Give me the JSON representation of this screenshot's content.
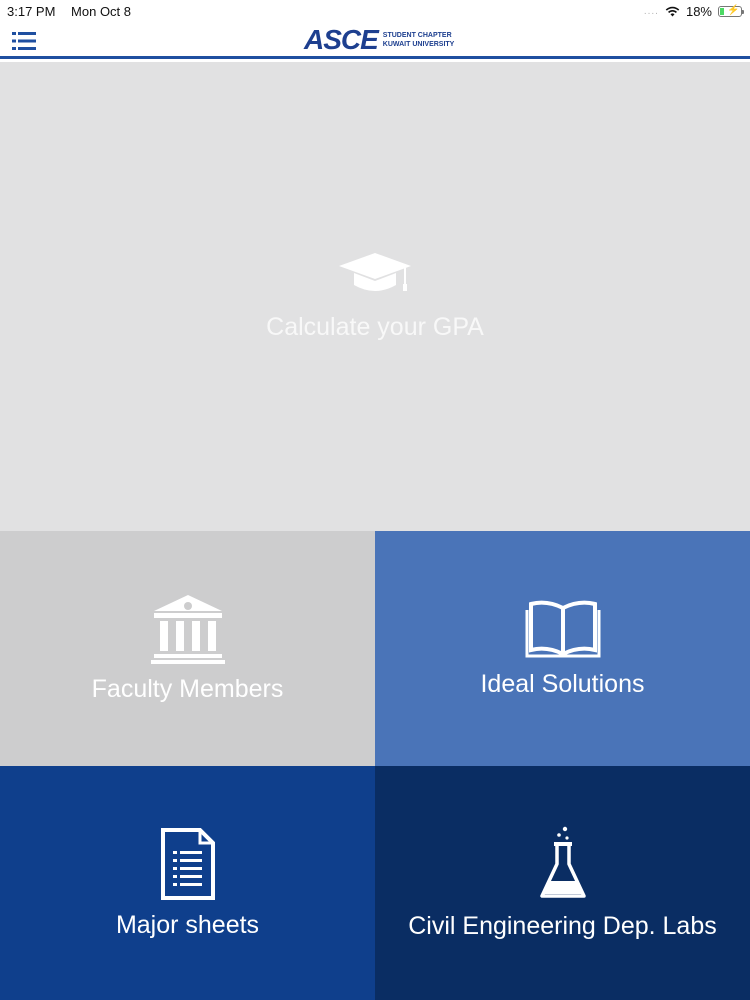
{
  "status_bar": {
    "time": "3:17 PM",
    "date": "Mon Oct 8",
    "signal_dots": "....",
    "wifi_icon": "wifi-icon",
    "battery_percent": "18%",
    "battery_level": 0.18,
    "battery_color": "#4cd964"
  },
  "header": {
    "menu_icon": "list-menu-icon",
    "logo_word": "ASCE",
    "logo_line1": "STUDENT CHAPTER",
    "logo_line2": "KUWAIT UNIVERSITY",
    "brand_color": "#1d3f8f",
    "rule_color": "#1f4fa0"
  },
  "tiles": {
    "gpa": {
      "label": "Calculate your GPA",
      "icon": "graduation-cap-icon",
      "color": "#e1e1e2"
    },
    "faculty": {
      "label": "Faculty Members",
      "icon": "institution-icon",
      "color": "#cdcdce"
    },
    "solutions": {
      "label": "Ideal Solutions",
      "icon": "open-book-icon",
      "color": "#4a74b8"
    },
    "sheets": {
      "label": "Major sheets",
      "icon": "document-list-icon",
      "color": "#0f3f8c"
    },
    "labs": {
      "label": "Civil Engineering Dep. Labs",
      "icon": "flask-icon",
      "color": "#0a2d63"
    }
  }
}
